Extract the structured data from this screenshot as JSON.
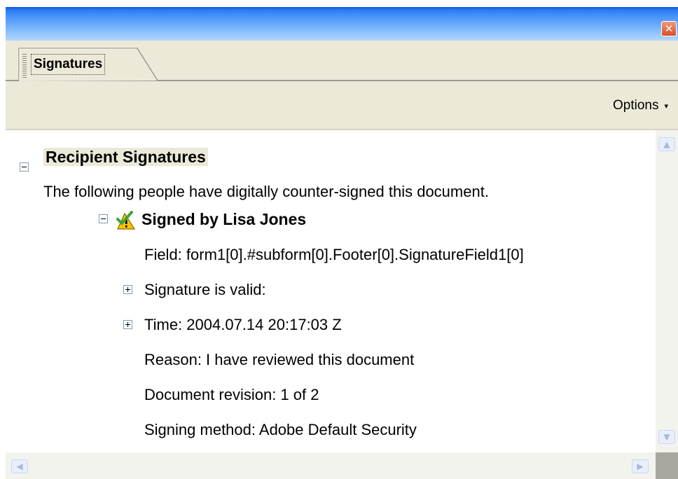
{
  "window": {
    "close_icon": "close-icon"
  },
  "tabs": [
    {
      "label": "Signatures"
    }
  ],
  "toolbar": {
    "options_label": "Options",
    "options_caret": "▾"
  },
  "panel": {
    "section_title": "Recipient Signatures",
    "section_description": "The following people have digitally counter-signed this document.",
    "signature": {
      "signer": "Signed by Lisa Jones",
      "status_icon": "signature-warning-check-icon",
      "field": "Field: form1[0].#subform[0].Footer[0].SignatureField1[0]",
      "validity": "Signature is valid:",
      "time": "Time: 2004.07.14 20:17:03 Z",
      "reason": "Reason: I have reviewed this document",
      "revision": "Document revision: 1 of 2",
      "method": "Signing method: Adobe Default Security"
    }
  },
  "colors": {
    "titlebar": "#3f8ef8",
    "chrome": "#ece9d8",
    "close_button": "#dc4d26",
    "check_green": "#3aa63a",
    "warning_yellow": "#f6c500"
  }
}
